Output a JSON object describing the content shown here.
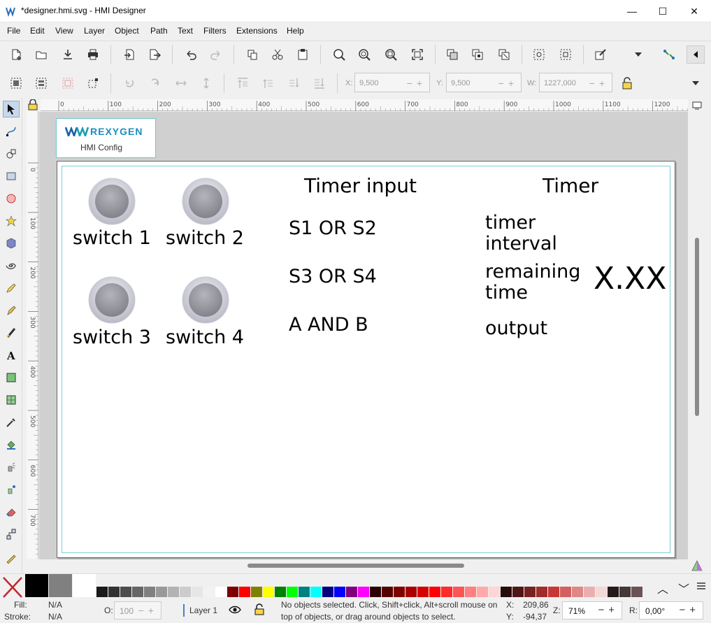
{
  "window": {
    "title": "*designer.hmi.svg - HMI Designer",
    "minimize_glyph": "—",
    "maximize_glyph": "☐",
    "close_glyph": "✕"
  },
  "menu": [
    "File",
    "Edit",
    "View",
    "Layer",
    "Object",
    "Path",
    "Text",
    "Filters",
    "Extensions",
    "Help"
  ],
  "toolbar2": {
    "x_label": "X:",
    "x_value": "9,500",
    "y_label": "Y:",
    "y_value": "9,500",
    "w_label": "W:",
    "w_value": "1227,000"
  },
  "ruler": {
    "h_ticks": [
      "0",
      "100",
      "200",
      "300",
      "400",
      "500",
      "600",
      "700",
      "800",
      "900",
      "1000",
      "1100",
      "1200"
    ],
    "v_ticks": [
      "0",
      "100",
      "200",
      "300",
      "400",
      "500",
      "600",
      "700"
    ]
  },
  "canvas": {
    "logo_text": "REXYGEN",
    "logo_subtitle": "HMI Config",
    "switches": [
      {
        "label": "switch 1"
      },
      {
        "label": "switch 2"
      },
      {
        "label": "switch 3"
      },
      {
        "label": "switch 4"
      }
    ],
    "timer_input_heading": "Timer input",
    "timer_inputs": [
      "S1 OR S2",
      "S3 OR S4",
      "A AND B"
    ],
    "timer_heading": "Timer",
    "timer_interval_line1": "timer",
    "timer_interval_line2": "interval",
    "remaining_line1": "remaining",
    "remaining_line2": "time",
    "output_label": "output",
    "value_display": "X.XX"
  },
  "palette_colors": [
    "#000000",
    "#808080",
    "#ffffff",
    "#1a1a1a",
    "#333333",
    "#4d4d4d",
    "#666666",
    "#808080",
    "#999999",
    "#b3b3b3",
    "#cccccc",
    "#e6e6e6",
    "#f2f2f2",
    "#ffffff",
    "#800000",
    "#ff0000",
    "#808000",
    "#ffff00",
    "#008000",
    "#00ff00",
    "#008080",
    "#00ffff",
    "#000080",
    "#0000ff",
    "#800080",
    "#ff00ff",
    "#2b0000",
    "#550000",
    "#800000",
    "#aa0000",
    "#d40000",
    "#ff0000",
    "#ff2a2a",
    "#ff5555",
    "#ff8080",
    "#ffaaaa",
    "#ffd5d5",
    "#280b0b",
    "#501616",
    "#782121",
    "#a02c2c",
    "#c83737",
    "#d35f5f",
    "#de8787",
    "#e9afaf",
    "#f4d7d7",
    "#241c1c",
    "#483737",
    "#6c5353"
  ],
  "status": {
    "fill_label": "Fill:",
    "fill_value": "N/A",
    "stroke_label": "Stroke:",
    "stroke_value": "N/A",
    "opacity_label": "O:",
    "opacity_value": "100",
    "layer": "Layer 1",
    "message_line1": "No objects selected. Click, Shift+click, Alt+scroll mouse on",
    "message_line2": "top of objects, or drag around objects to select.",
    "x_label": "X:",
    "x_value": "209,86",
    "y_label": "Y:",
    "y_value": "-94,37",
    "zoom_label": "Z:",
    "zoom_value": "71%",
    "rotation_label": "R:",
    "rotation_value": "0,00°"
  }
}
